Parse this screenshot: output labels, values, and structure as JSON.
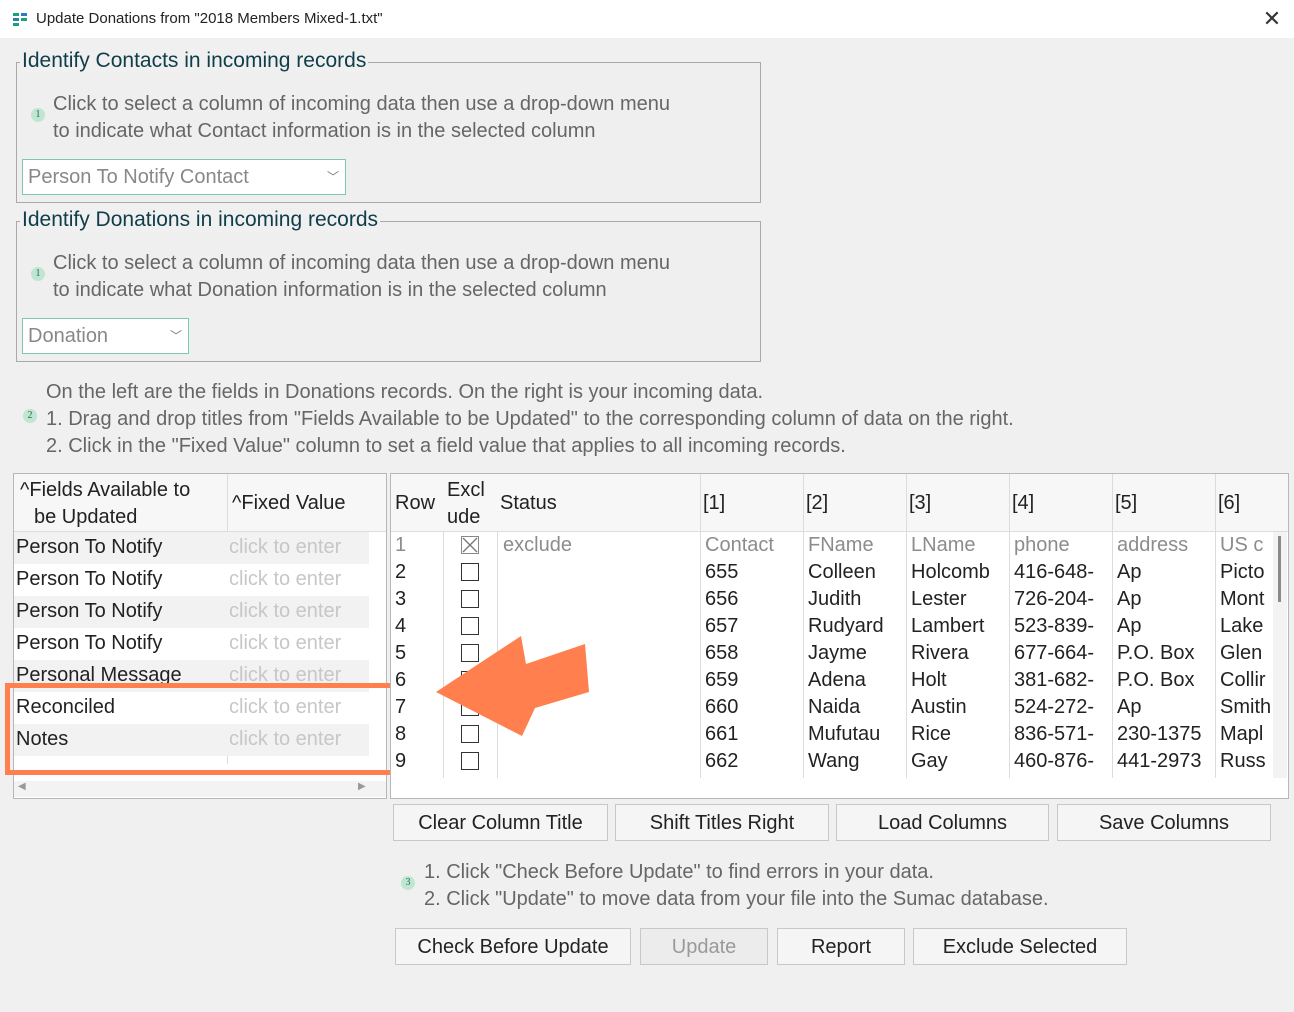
{
  "window": {
    "title": "Update Donations from \"2018 Members Mixed-1.txt\""
  },
  "contacts_group": {
    "legend": "Identify Contacts in incoming records",
    "step": "1",
    "line1": "Click to select a column of incoming data then use a drop-down menu",
    "line2": "to indicate what Contact information is in the selected column",
    "combo_value": "Person To Notify Contact"
  },
  "donations_group": {
    "legend": "Identify Donations in incoming records",
    "step": "1",
    "line1": "Click to select a column of incoming data then use a drop-down menu",
    "line2": "to indicate what Donation information is in the selected column",
    "combo_value": "Donation"
  },
  "mapping_instructions": {
    "step": "2",
    "line1": "On the left are the fields in Donations records. On the right is your incoming data.",
    "line2": "1. Drag and drop titles from \"Fields Available to be Updated\" to the corresponding column of data on the right.",
    "line3": "2. Click in the \"Fixed Value\" column to set a field value that applies to all incoming records."
  },
  "fields_table": {
    "header_fields_1": "^Fields Available to",
    "header_fields_2": "be Updated",
    "header_fixed": "^Fixed Value",
    "rows": [
      {
        "field": "Person To Notify",
        "fixed": "click to enter"
      },
      {
        "field": "Person To Notify",
        "fixed": "click to enter"
      },
      {
        "field": "Person To Notify",
        "fixed": "click to enter"
      },
      {
        "field": "Person To Notify",
        "fixed": "click to enter"
      },
      {
        "field": "Personal Message",
        "fixed": "click to enter"
      },
      {
        "field": "Reconciled",
        "fixed": "click to enter"
      },
      {
        "field": "Notes",
        "fixed": "click to enter"
      }
    ]
  },
  "data_table": {
    "headers": {
      "row": "Row",
      "exclude_1": "Excl",
      "exclude_2": "ude",
      "status": "Status",
      "c1": "[1]",
      "c2": "[2]",
      "c3": "[3]",
      "c4": "[4]",
      "c5": "[5]",
      "c6": "[6]"
    },
    "rows": [
      {
        "row": "1",
        "excluded": true,
        "status": "exclude",
        "c1": "Contact",
        "c2": "FName",
        "c3": "LName",
        "c4": "phone",
        "c5": "address",
        "c6": "US c"
      },
      {
        "row": "2",
        "excluded": false,
        "status": "",
        "c1": "655",
        "c2": "Colleen",
        "c3": "Holcomb",
        "c4": "416-648-",
        "c5": "Ap",
        "c6": "Picto"
      },
      {
        "row": "3",
        "excluded": false,
        "status": "",
        "c1": "656",
        "c2": "Judith",
        "c3": "Lester",
        "c4": "726-204-",
        "c5": "Ap",
        "c6": "Mont"
      },
      {
        "row": "4",
        "excluded": false,
        "status": "",
        "c1": "657",
        "c2": "Rudyard",
        "c3": "Lambert",
        "c4": "523-839-",
        "c5": "Ap",
        "c6": "Lake"
      },
      {
        "row": "5",
        "excluded": false,
        "status": "",
        "c1": "658",
        "c2": "Jayme",
        "c3": "Rivera",
        "c4": "677-664-",
        "c5": "P.O. Box",
        "c6": "Glen"
      },
      {
        "row": "6",
        "excluded": false,
        "status": "",
        "c1": "659",
        "c2": "Adena",
        "c3": "Holt",
        "c4": "381-682-",
        "c5": "P.O. Box",
        "c6": "Collir"
      },
      {
        "row": "7",
        "excluded": false,
        "status": "",
        "c1": "660",
        "c2": "Naida",
        "c3": "Austin",
        "c4": "524-272-",
        "c5": "Ap",
        "c6": "Smith"
      },
      {
        "row": "8",
        "excluded": false,
        "status": "",
        "c1": "661",
        "c2": "Mufutau",
        "c3": "Rice",
        "c4": "836-571-",
        "c5": "230-1375",
        "c6": "Mapl"
      },
      {
        "row": "9",
        "excluded": false,
        "status": "",
        "c1": "662",
        "c2": "Wang",
        "c3": "Gay",
        "c4": "460-876-",
        "c5": "441-2973",
        "c6": "Russ"
      }
    ]
  },
  "column_buttons": {
    "clear": "Clear Column Title",
    "shift": "Shift Titles Right",
    "load": "Load Columns",
    "save": "Save Columns"
  },
  "update_instructions": {
    "step": "3",
    "line1": "1. Click \"Check Before Update\" to find errors in your data.",
    "line2": "2. Click \"Update\" to move data from your file into the Sumac database."
  },
  "action_buttons": {
    "check": "Check Before Update",
    "update": "Update",
    "report": "Report",
    "exclude": "Exclude Selected"
  },
  "colors": {
    "highlight_orange": "#ff7f4f",
    "accent_teal": "#7fc7b5",
    "heading_teal": "#0f3d4a"
  }
}
